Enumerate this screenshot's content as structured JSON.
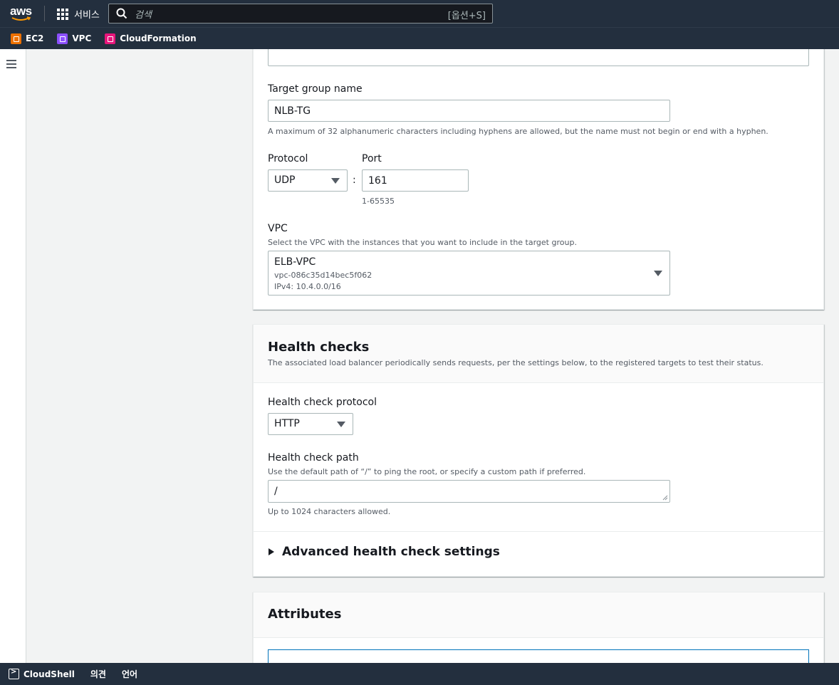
{
  "topnav": {
    "logo": "aws",
    "services_label": "서비스",
    "search_placeholder": "검색",
    "search_shortcut": "[옵션+S]"
  },
  "favorites": [
    {
      "label": "EC2",
      "color": "#ed7100",
      "icon": "ec2-icon"
    },
    {
      "label": "VPC",
      "color": "#8c4fff",
      "icon": "vpc-icon"
    },
    {
      "label": "CloudFormation",
      "color": "#e7157b",
      "icon": "cloudformation-icon"
    }
  ],
  "target_group": {
    "name_label": "Target group name",
    "name_value": "NLB-TG",
    "name_hint": "A maximum of 32 alphanumeric characters including hyphens are allowed, but the name must not begin or end with a hyphen.",
    "protocol_label": "Protocol",
    "protocol_value": "UDP",
    "port_label": "Port",
    "port_separator": ":",
    "port_value": "161",
    "port_hint": "1-65535",
    "vpc_label": "VPC",
    "vpc_desc": "Select the VPC with the instances that you want to include in the target group.",
    "vpc_name": "ELB-VPC",
    "vpc_id": "vpc-086c35d14bec5f062",
    "vpc_cidr": "IPv4: 10.4.0.0/16"
  },
  "health_checks": {
    "title": "Health checks",
    "desc": "The associated load balancer periodically sends requests, per the settings below, to the registered targets to test their status.",
    "protocol_label": "Health check protocol",
    "protocol_value": "HTTP",
    "path_label": "Health check path",
    "path_desc": "Use the default path of “/” to ping the root, or specify a custom path if preferred.",
    "path_value": "/",
    "path_hint": "Up to 1024 characters allowed.",
    "advanced_label": "Advanced health check settings"
  },
  "attributes": {
    "title": "Attributes"
  },
  "bottombar": {
    "cloudshell": "CloudShell",
    "feedback": "의견",
    "language": "언어"
  }
}
